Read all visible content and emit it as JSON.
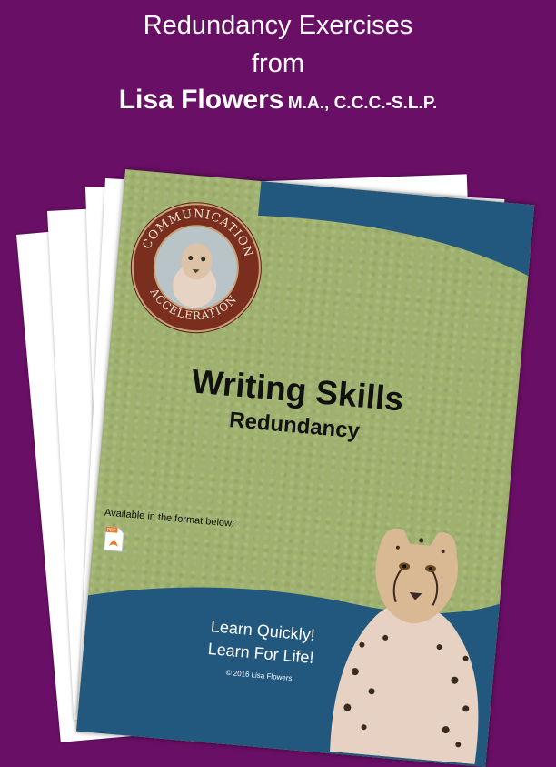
{
  "header": {
    "line1": "Redundancy Exercises",
    "line2": "from",
    "author_name": "Lisa Flowers",
    "author_credentials": "M.A., C.C.C.-S.L.P."
  },
  "cover": {
    "logo_top_text": "COMMUNICATION",
    "logo_bottom_text": "ACCELERATION",
    "title": "Writing Skills",
    "subtitle": "Redundancy",
    "available_text": "Available in the format below:",
    "pdf_label": "PDF",
    "tagline_line1": "Learn Quickly!",
    "tagline_line2": "Learn For Life!",
    "copyright": "© 2016 Lisa Flowers"
  },
  "colors": {
    "background": "#6a0f66",
    "cover_green": "#9fb16e",
    "band_blue": "#23587e",
    "pdf_orange": "#e87722"
  },
  "icons": [
    "pdf-icon",
    "cheetah-logo",
    "cheetah-illustration"
  ]
}
